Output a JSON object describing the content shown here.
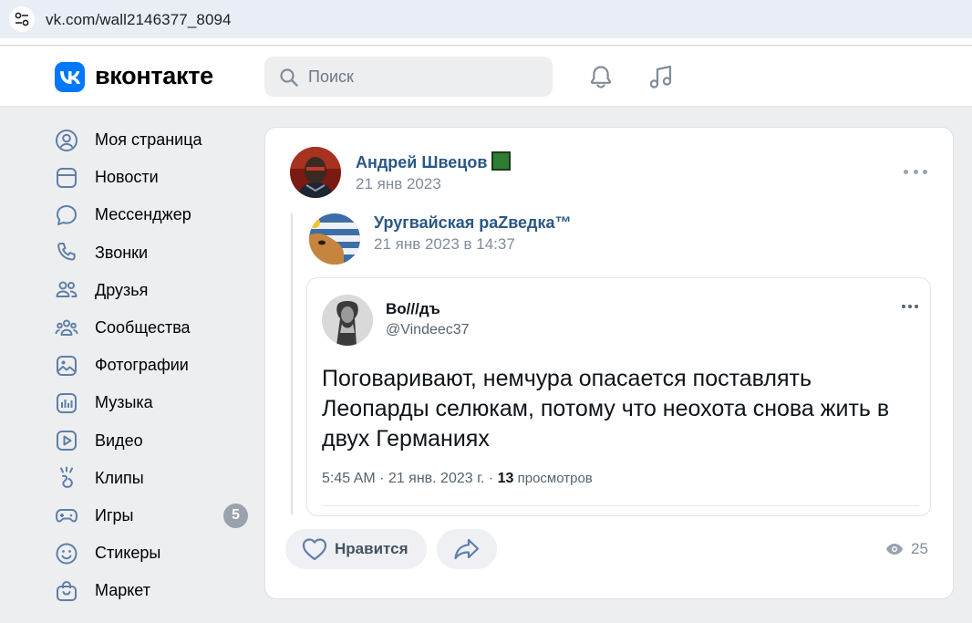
{
  "browser": {
    "url": "vk.com/wall2146377_8094"
  },
  "header": {
    "logo_text": "вконтакте",
    "search_placeholder": "Поиск"
  },
  "sidebar": {
    "items": [
      {
        "label": "Моя страница",
        "icon": "user-circle-icon"
      },
      {
        "label": "Новости",
        "icon": "news-icon"
      },
      {
        "label": "Мессенджер",
        "icon": "message-bubble-icon"
      },
      {
        "label": "Звонки",
        "icon": "phone-icon"
      },
      {
        "label": "Друзья",
        "icon": "friends-icon"
      },
      {
        "label": "Сообщества",
        "icon": "communities-icon"
      },
      {
        "label": "Фотографии",
        "icon": "photo-icon"
      },
      {
        "label": "Музыка",
        "icon": "music-icon"
      },
      {
        "label": "Видео",
        "icon": "video-icon"
      },
      {
        "label": "Клипы",
        "icon": "clips-icon"
      },
      {
        "label": "Игры",
        "icon": "gamepad-icon",
        "badge": "5"
      },
      {
        "label": "Стикеры",
        "icon": "sticker-icon"
      },
      {
        "label": "Маркет",
        "icon": "market-bag-icon"
      }
    ]
  },
  "post": {
    "author": "Андрей Швецов",
    "date": "21 янв 2023",
    "repost": {
      "author": "Уругвайская раZведка™",
      "date": "21 янв 2023 в 14:37"
    },
    "tweet": {
      "name": "Во///дъ",
      "handle": "@Vindeec37",
      "text": "Поговаривают, немчура опасается поставлять Леопарды селюкам, потому что неохота снова жить в двух Германиях",
      "meta_time": "5:45 AM · 21 янв. 2023 г. · ",
      "meta_views_count": "13",
      "meta_views_label": " просмотров"
    },
    "like_label": "Нравится",
    "views": "25"
  },
  "colors": {
    "brand": "#0077ff",
    "link": "#2a5885",
    "secondary_text": "#818c99",
    "icon": "#5f7fa8"
  }
}
